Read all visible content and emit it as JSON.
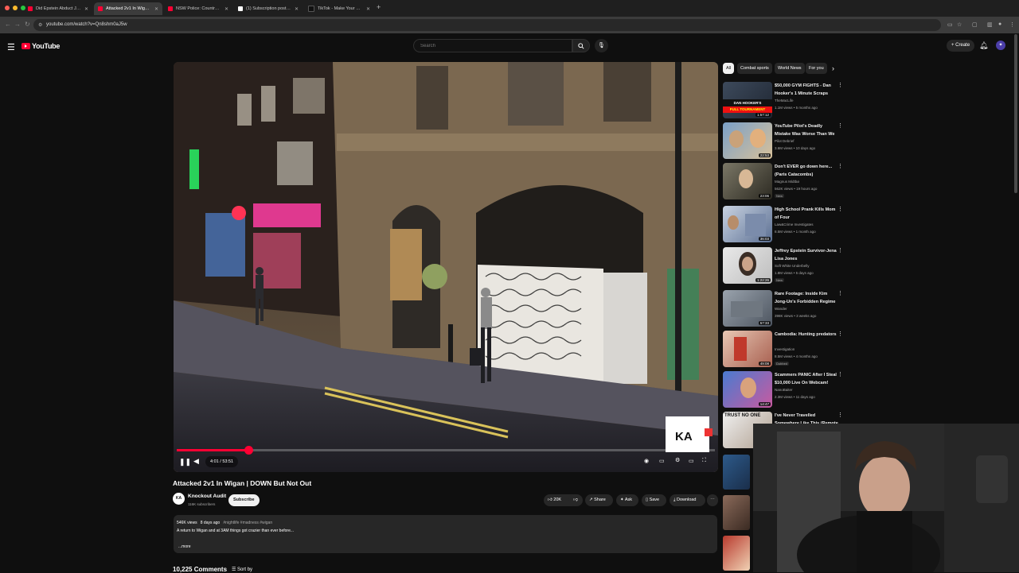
{
  "browser": {
    "tabs": [
      {
        "title": "Did Epstein Abduct JonBenét"
      },
      {
        "title": "Attacked 2v1 In Wigan | D"
      },
      {
        "title": "NSW Police: Country Cop vs"
      },
      {
        "title": "(1) Subscription posts by Wi"
      },
      {
        "title": "TikTok - Make Your Day"
      }
    ],
    "url": "youtube.com/watch?v=Qn8shm0aJ5w"
  },
  "masthead": {
    "logo_text": "YouTube",
    "search_placeholder": "Search",
    "create_label": "Create"
  },
  "player": {
    "time_current": "4:01",
    "time_total": "53:51",
    "progress": 0.133,
    "watermark_text": "KA"
  },
  "video": {
    "title": "Attacked 2v1 In Wigan | DOWN But Not Out",
    "channel_name": "Knockout Audit",
    "channel_subs": "116K subscribers",
    "channel_initials": "KA",
    "subscribe_label": "Subscribe",
    "likes": "20K",
    "share_label": "Share",
    "ask_label": "Ask",
    "save_label": "Save",
    "download_label": "Download"
  },
  "description": {
    "views": "546K views",
    "age": "8 days ago",
    "tags": "#nightlife #madness #wigan",
    "text": "A return to Wigan and at 3AM things got crazier than ever before...",
    "more_label": "...more"
  },
  "comments": {
    "count_label": "10,225 Comments",
    "sort_label": "Sort by"
  },
  "sidebar": {
    "chips": [
      "All",
      "Combat sports",
      "World News",
      "For you"
    ],
    "recommendations": [
      {
        "title": "$50,000 GYM FIGHTS - Dan Hooker's 1 Minute Scraps",
        "channel": "TheMacLife",
        "meta": "1.1M views • 5 months ago",
        "duration": "1:57:12",
        "badge": ""
      },
      {
        "title": "YouTube Pilot's Deadly Mistake Was Worse Than We Thought!",
        "channel": "Pilot Debrief",
        "meta": "3.6M views • 10 days ago",
        "duration": "22:53",
        "badge": ""
      },
      {
        "title": "Don't EVER go down here... (Paris Catacombs)",
        "channel": "Magnus Midtbø",
        "meta": "562K views • 19 hours ago",
        "duration": "23:06",
        "badge": "New"
      },
      {
        "title": "High School Prank Kills Mom of Four",
        "channel": "Law&Crime Investigates",
        "meta": "8.5M views • 1 month ago",
        "duration": "36:03",
        "badge": ""
      },
      {
        "title": "Jeffrey Epstein Survivor-Jena Lisa Jones",
        "channel": "Soft White Underbelly",
        "meta": "1.8M views • 5 days ago",
        "duration": "1:22:26",
        "badge": "New"
      },
      {
        "title": "Rare Footage: Inside Kim Jong-Un's Forbidden Regime",
        "channel": "Wander",
        "meta": "398K views • 3 weeks ago",
        "duration": "57:33",
        "badge": ""
      },
      {
        "title": "Cambodia: Hunting predators",
        "channel": "Investigation",
        "meta": "8.5M views • 4 months ago",
        "duration": "49:08",
        "badge": "Dubbed"
      },
      {
        "title": "Scammers PANIC After I Steal $10,000 Live On Webcam!",
        "channel": "NanoBaiter",
        "meta": "2.3M views • 11 days ago",
        "duration": "14:47",
        "badge": ""
      },
      {
        "title": "I've Never Travelled Somewhere Like This (Remote PNG)",
        "channel": "",
        "meta": "",
        "duration": "",
        "badge": ""
      }
    ]
  },
  "colors": {
    "background": "#0f0f0f",
    "accent_red": "#ff0033",
    "chip_bg": "#272727"
  }
}
